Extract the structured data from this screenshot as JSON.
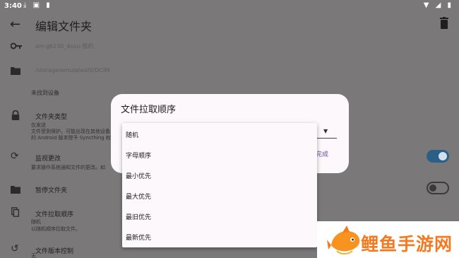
{
  "status_bar": {
    "time": "3:40",
    "left_icons": "⤓ ▣ ▮",
    "right_icons": "▼ ◢ ▮"
  },
  "app_bar": {
    "title": "编辑文件夹"
  },
  "rows": {
    "id_text": "sm-g6230_4sou-我的",
    "path_text": "/storage/emulated/0/DCIM",
    "not_found": "未找到设备",
    "folder_type": {
      "title": "文件夹类型",
      "line1": "仅发送",
      "line2": "文件受到保护。可能出现在其他设备上",
      "line3": "的 Android 版本授予 Syncthing 权"
    },
    "watch_changes": {
      "title": "监视更改",
      "sub": "要求操作系统通知文件的更改。如"
    },
    "pause_folder": {
      "title": "暂停文件夹"
    },
    "pull_order": {
      "title": "文件拉取顺序",
      "line1": "随机",
      "line2": "以随机顺序拉取文件。"
    },
    "versioning": {
      "title": "文件版本控制",
      "line1": "无"
    }
  },
  "dialog": {
    "title": "文件拉取顺序",
    "done_label": "完成"
  },
  "menu": {
    "items": [
      "随机",
      "字母顺序",
      "最小优先",
      "最大优先",
      "最旧优先",
      "最新优先"
    ]
  },
  "watermark": {
    "text": "鲤鱼手游网"
  },
  "colors": {
    "scrim": "#7a7878",
    "surface": "#fcf8fb",
    "accent": "#6b4ea2",
    "toggle_on": "#2b5f86",
    "brand_orange": "#f47a21"
  }
}
